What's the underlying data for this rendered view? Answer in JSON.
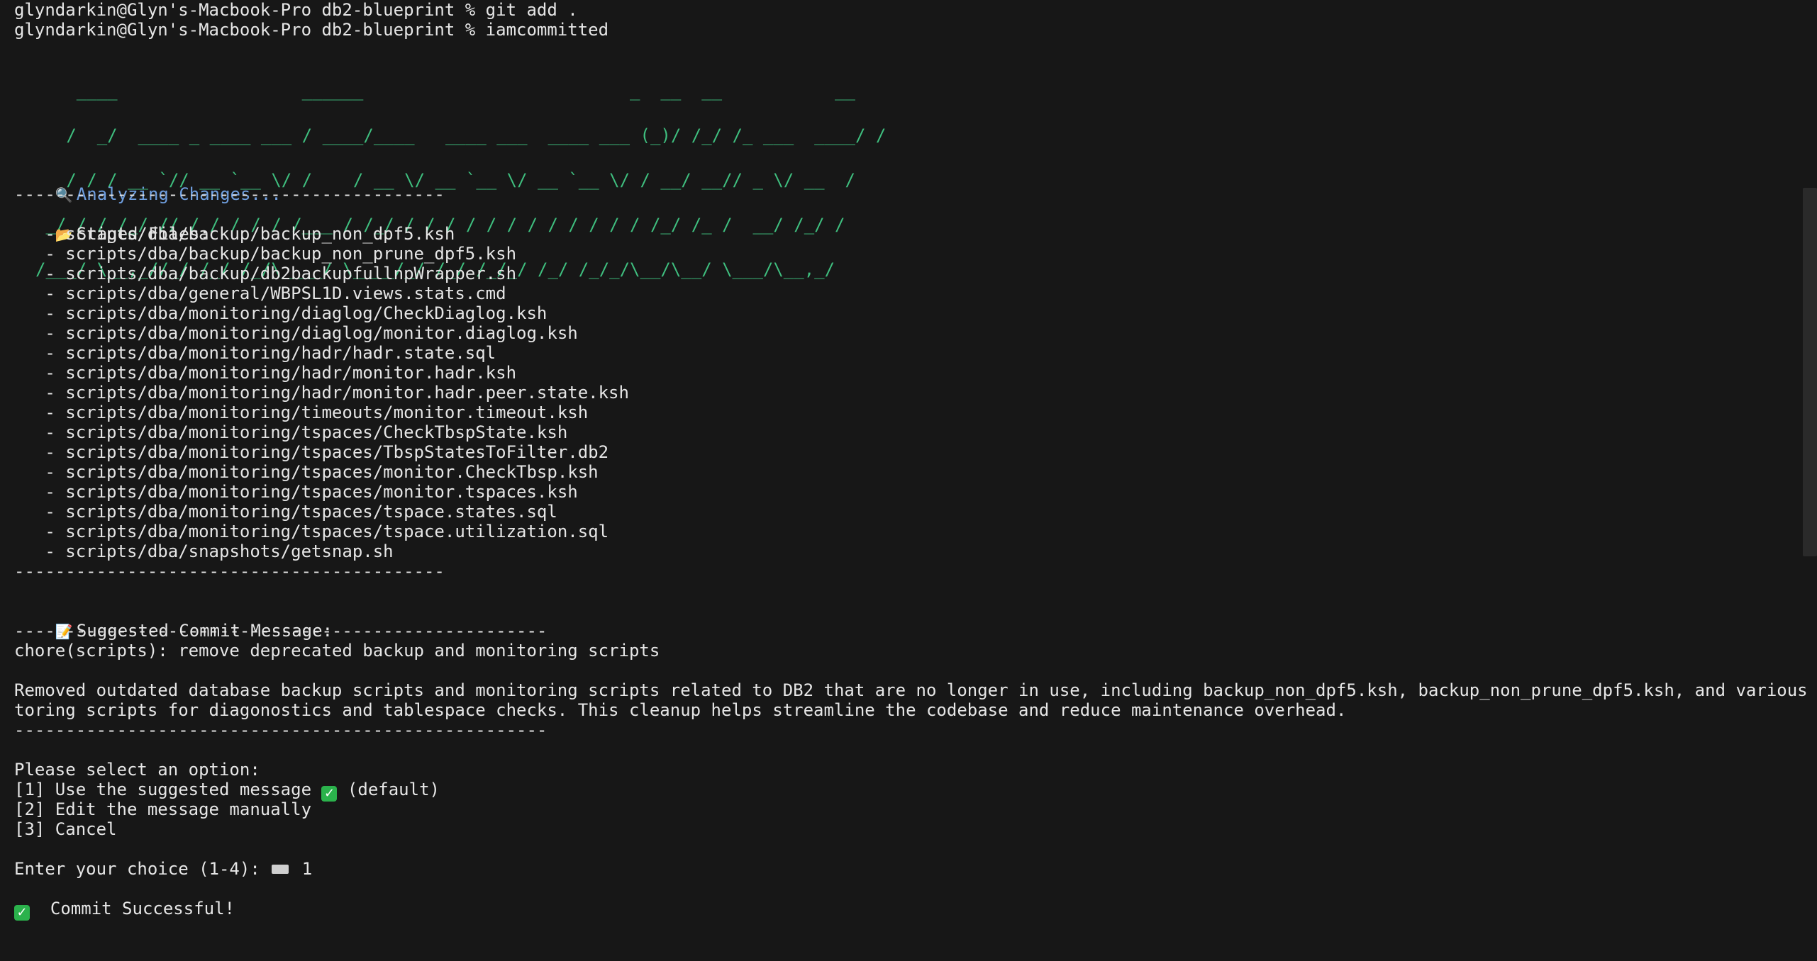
{
  "prompt_lines": [
    "glyndarkin@Glyn's-Macbook-Pro db2-blueprint % git add .",
    "glyndarkin@Glyn's-Macbook-Pro db2-blueprint % iamcommitted"
  ],
  "banner_ascii": [
    "    ____                  ______                          _  __  __           __",
    "   /  _/  ____ _ ____ ___ / ____/____   ____ ___  ____ ___ (_)/ /_/ /_ ___  ____/ /",
    "   / / / __ `// __ `__ \\/ /    / __ \\/ __ `__ \\/ __ `__ \\/ / __/ __// _ \\/ __  / ",
    " _/ / / /_/ // / / / / / /___ / /_/ / / / / / / / / / / / / /_/ /_ /  __/ /_/ /  ",
    "/___/ \\__,_//_/ /_/ /_/\\____/ \\____/_/ /_/ /_/_/ /_/ /_/_/\\__/\\__/ \\___/\\__,_/   "
  ],
  "analyzing": {
    "icon": "magnifier-icon",
    "label": "Analyzing Changes...",
    "color": "#6f9fe0"
  },
  "separator_short": "------------------------------------------",
  "separator_long": "----------------------------------------------------",
  "staged": {
    "icon": "folder-icon",
    "label": "Staged Files:",
    "files": [
      "scripts/dba/backup/backup_non_dpf5.ksh",
      "scripts/dba/backup/backup_non_prune_dpf5.ksh",
      "scripts/dba/backup/db2backupfullnpWrapper.sh",
      "scripts/dba/general/WBPSL1D.views.stats.cmd",
      "scripts/dba/monitoring/diaglog/CheckDiaglog.ksh",
      "scripts/dba/monitoring/diaglog/monitor.diaglog.ksh",
      "scripts/dba/monitoring/hadr/hadr.state.sql",
      "scripts/dba/monitoring/hadr/monitor.hadr.ksh",
      "scripts/dba/monitoring/hadr/monitor.hadr.peer.state.ksh",
      "scripts/dba/monitoring/timeouts/monitor.timeout.ksh",
      "scripts/dba/monitoring/tspaces/CheckTbspState.ksh",
      "scripts/dba/monitoring/tspaces/TbspStatesToFilter.db2",
      "scripts/dba/monitoring/tspaces/monitor.CheckTbsp.ksh",
      "scripts/dba/monitoring/tspaces/monitor.tspaces.ksh",
      "scripts/dba/monitoring/tspaces/tspace.states.sql",
      "scripts/dba/monitoring/tspaces/tspace.utilization.sql",
      "scripts/dba/snapshots/getsnap.sh"
    ]
  },
  "suggested": {
    "icon": "memo-icon",
    "label": "Suggested Commit Message:",
    "subject": "chore(scripts): remove deprecated backup and monitoring scripts",
    "body_line1": "Removed outdated database backup scripts and monitoring scripts related to DB2 that are no longer in use, including backup_non_dpf5.ksh, backup_non_prune_dpf5.ksh, and various moni",
    "body_line2": "toring scripts for diagonostics and tablespace checks. This cleanup helps streamline the codebase and reduce maintenance overhead."
  },
  "options": {
    "prompt": "Please select an option:",
    "opt1_a": "[1] Use the suggested message ",
    "opt1_b": " (default)",
    "opt2": "[2] Edit the message manually",
    "opt3": "[3] Cancel"
  },
  "choice": {
    "prompt": "Enter your choice (1-4): ",
    "value": "1"
  },
  "result": {
    "label": "Commit Successful!",
    "icon": "check-icon",
    "color": "#2bb24c"
  },
  "colors": {
    "background": "#171717",
    "text": "#e6e6e6",
    "banner": "#3fbf7f"
  }
}
